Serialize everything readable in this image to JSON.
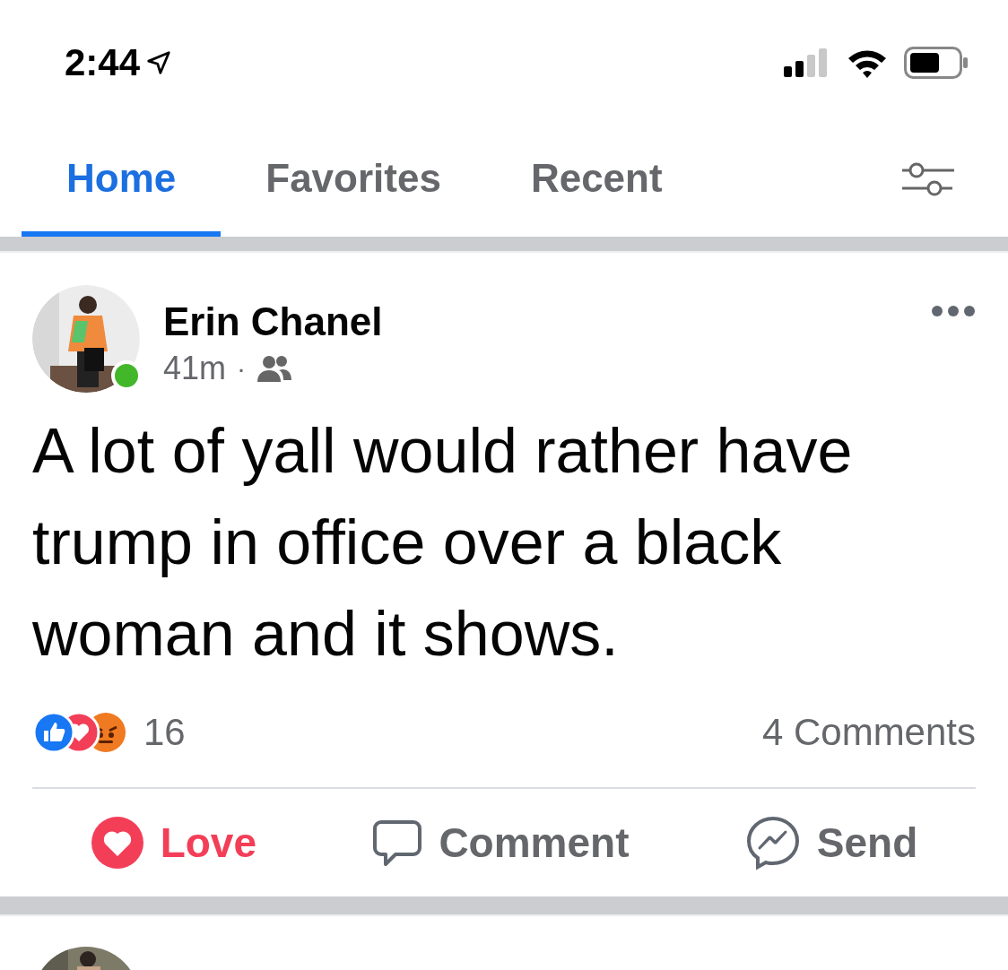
{
  "status_bar": {
    "time": "2:44",
    "location_on": true
  },
  "tabs": [
    {
      "label": "Home",
      "selected": true
    },
    {
      "label": "Favorites",
      "selected": false
    },
    {
      "label": "Recent",
      "selected": false
    }
  ],
  "post": {
    "author": "Erin Chanel",
    "online": true,
    "time": "41m",
    "separator": "·",
    "shared_with_friends": true,
    "text": "A lot of yall would rather have trump in office over a black woman and it shows.",
    "reaction_count": "16",
    "comments": "4 Comments",
    "actions": [
      {
        "kind": "love",
        "label": "Love",
        "active": true
      },
      {
        "kind": "comment",
        "label": "Comment",
        "active": false
      },
      {
        "kind": "send",
        "label": "Send",
        "active": false
      }
    ]
  }
}
